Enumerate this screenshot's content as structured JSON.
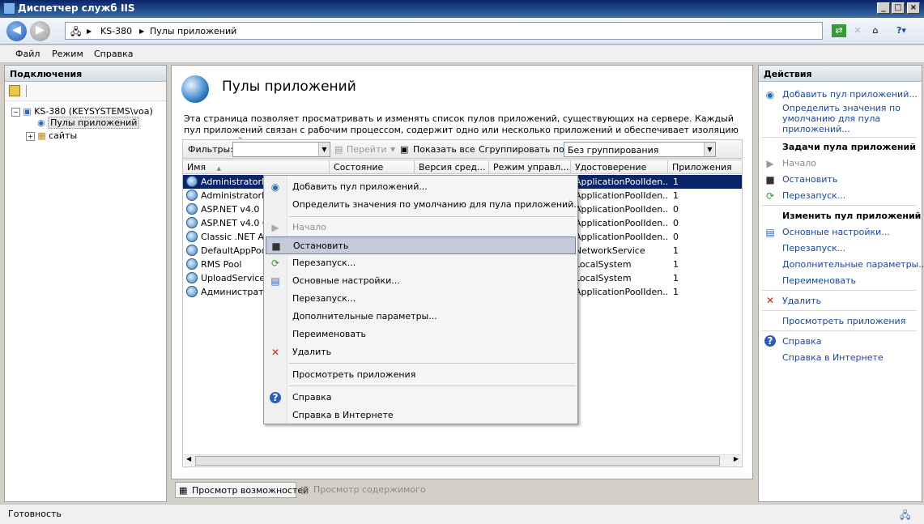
{
  "window": {
    "title": "Диспетчер служб IIS"
  },
  "address": {
    "crumbs": [
      "KS-380",
      "Пулы приложений"
    ]
  },
  "menu": {
    "items": [
      "Файл",
      "Режим",
      "Справка"
    ]
  },
  "connections": {
    "header": "Подключения",
    "tree": {
      "server": "KS-380 (KEYSYSTEMS\\voa)",
      "pools": "Пулы приложений",
      "sites": "сайты"
    }
  },
  "main": {
    "title": "Пулы приложений",
    "description": "Эта страница позволяет просматривать и изменять список пулов приложений, существующих на сервере. Каждый пул приложений связан с рабочим процессом, содержит одно или несколько приложений и обеспечивает изоляцию приложений друг от друга.",
    "filter_label": "Фильтры:",
    "go_label": "Перейти",
    "show_all_label": "Показать все",
    "group_label": "Сгруппировать по:",
    "group_value": "Без группирования",
    "columns": [
      "Имя",
      "Состояние",
      "Версия сред...",
      "Режим управл...",
      "Удостоверение",
      "Приложения"
    ],
    "rows": [
      {
        "name": "AdministratorD P",
        "identity": "ApplicationPoolIden...",
        "apps": "1"
      },
      {
        "name": "AdministratorD P",
        "identity": "ApplicationPoolIden...",
        "apps": "1"
      },
      {
        "name": "ASP.NET v4.0",
        "identity": "ApplicationPoolIden...",
        "apps": "0"
      },
      {
        "name": "ASP.NET v4.0 Cl",
        "identity": "ApplicationPoolIden...",
        "apps": "0"
      },
      {
        "name": "Classic .NET App",
        "identity": "ApplicationPoolIden...",
        "apps": "0"
      },
      {
        "name": "DefaultAppPool",
        "identity": "NetworkService",
        "apps": "1"
      },
      {
        "name": "RMS Pool",
        "identity": "LocalSystem",
        "apps": "1"
      },
      {
        "name": "UploadService Po",
        "identity": "LocalSystem",
        "apps": "1"
      },
      {
        "name": "Администратор",
        "identity": "ApplicationPoolIden...",
        "apps": "1"
      }
    ],
    "tabs": [
      "Просмотр возможностей",
      "Просмотр содержимого"
    ]
  },
  "context_menu": {
    "items": [
      "Добавить пул приложений...",
      "Определить значения по умолчанию для пула приложений...",
      "Начало",
      "Остановить",
      "Перезапуск...",
      "Основные настройки...",
      "Перезапуск...",
      "Дополнительные параметры...",
      "Переименовать",
      "Удалить",
      "Просмотреть приложения",
      "Справка",
      "Справка в Интернете"
    ]
  },
  "actions": {
    "header": "Действия",
    "add_pool": "Добавить пул приложений...",
    "set_defaults": [
      "Определить значения по",
      "умолчанию для пула",
      "приложений..."
    ],
    "tasks_header": "Задачи пула приложений",
    "start": "Начало",
    "stop": "Остановить",
    "restart": "Перезапуск...",
    "edit_header": "Изменить пул приложений",
    "basic_settings": "Основные настройки...",
    "recycle": "Перезапуск...",
    "advanced": "Дополнительные параметры...",
    "rename": "Переименовать",
    "delete": "Удалить",
    "view_apps": "Просмотреть приложения",
    "help": "Справка",
    "help_online": "Справка в Интернете"
  },
  "status": {
    "text": "Готовность"
  },
  "colors": {
    "selection": "#0a246a",
    "link": "#1a46a6",
    "delete": "#cc2222"
  }
}
